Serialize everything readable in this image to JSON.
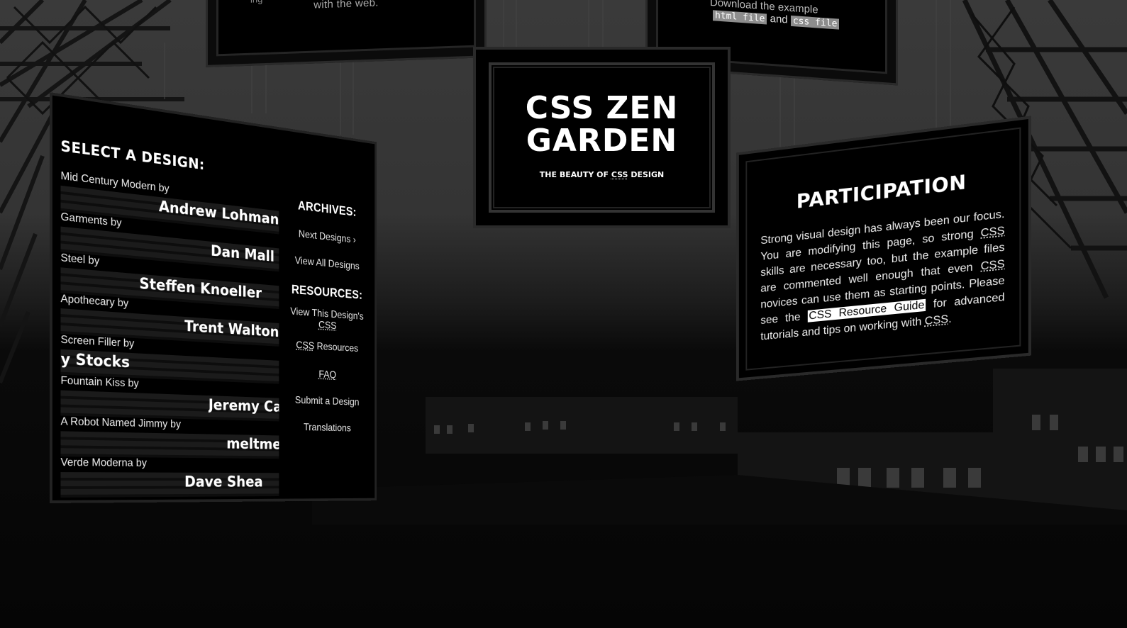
{
  "top_left_board": {
    "text_line1": "ing",
    "text_line2": "with the web."
  },
  "top_right_board": {
    "text": "Download the example",
    "link_html": "html file",
    "and_word": "and",
    "link_css": "css file"
  },
  "header": {
    "title_line1": "CSS ZEN",
    "title_line2": "GARDEN",
    "subtitle_prefix": "THE BEAUTY OF ",
    "subtitle_abbr": "CSS",
    "subtitle_suffix": " DESIGN"
  },
  "select_design": {
    "heading": "SELECT A DESIGN:",
    "designs": [
      {
        "name": "Mid Century Modern by",
        "author": "Andrew Lohman"
      },
      {
        "name": "Garments by",
        "author": "Dan Mall"
      },
      {
        "name": "Steel by",
        "author": "Steffen Knoeller"
      },
      {
        "name": "Apothecary by",
        "author": "Trent Walton"
      },
      {
        "name": "Screen Filler by",
        "author": "y Stocks"
      },
      {
        "name": "Fountain Kiss by",
        "author": "Jeremy Carlson"
      },
      {
        "name": "A Robot Named Jimmy by",
        "author": "meltmedia"
      },
      {
        "name": "Verde Moderna by",
        "author": "Dave Shea"
      }
    ]
  },
  "archives": {
    "heading": "ARCHIVES:",
    "next": "Next Designs ›",
    "view_all": "View All Designs"
  },
  "resources": {
    "heading": "RESOURCES:",
    "view_css_line1": "View This Design's",
    "view_css_line2": "CSS",
    "css_resources_abbr": "CSS",
    "css_resources_rest": " Resources",
    "faq": "FAQ",
    "submit": "Submit a Design",
    "translations": "Translations"
  },
  "participation": {
    "heading": "PARTICIPATION",
    "p1": "Strong visual design has always been our focus. You are modifying this page, so strong ",
    "css1": "CSS",
    "p2": " skills are necessary too, but the example files are commented well enough that even ",
    "css2": "CSS",
    "p3": " novices can use them as starting points. Please see the ",
    "guide": "CSS Resource Guide",
    "p4": " for advanced tutorials and tips on working with ",
    "css3": "CSS",
    "p5": "."
  }
}
